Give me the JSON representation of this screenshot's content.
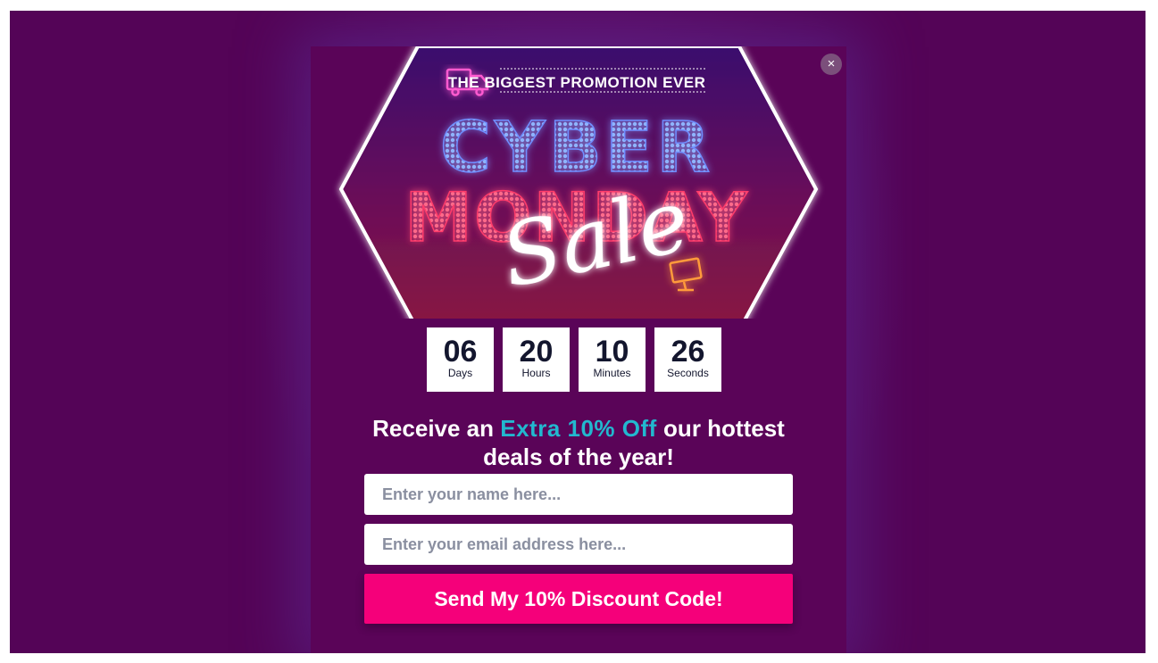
{
  "popup": {
    "close_label": "×",
    "banner": {
      "tagline": "THE BIGGEST PROMOTION EVER",
      "line1": "CYBER",
      "line2": "MONDAY",
      "script_word": "Sale",
      "icons": [
        "truck-icon",
        "monitor-icon"
      ]
    },
    "countdown": [
      {
        "value": "06",
        "label": "Days"
      },
      {
        "value": "20",
        "label": "Hours"
      },
      {
        "value": "10",
        "label": "Minutes"
      },
      {
        "value": "26",
        "label": "Seconds"
      }
    ],
    "headline": {
      "before": "Receive an ",
      "accent": "Extra 10% Off",
      "after": " our hottest deals of the year!"
    },
    "form": {
      "name_placeholder": "Enter your name here...",
      "email_placeholder": "Enter your email address here...",
      "submit_label": "Send My 10% Discount Code!"
    }
  },
  "colors": {
    "backdrop": "#540457",
    "popup": "#5a0458",
    "accent": "#22b8cf",
    "button": "#f5007a"
  }
}
